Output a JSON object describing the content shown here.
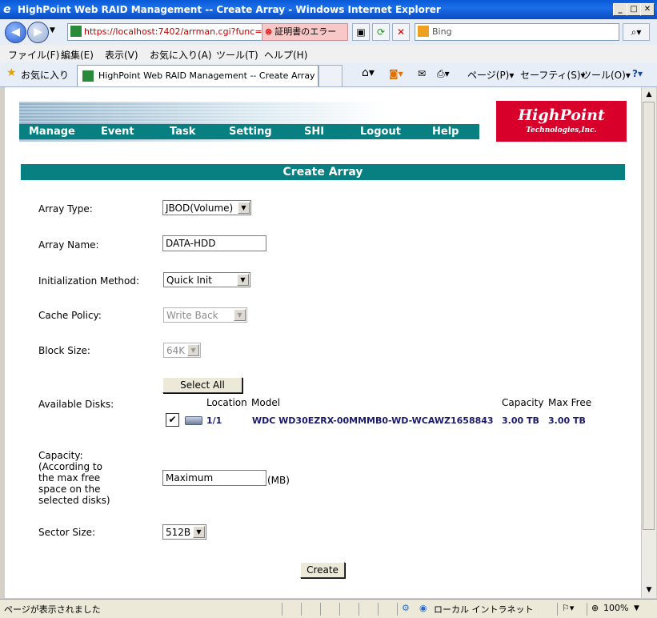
{
  "window": {
    "title": "HighPoint Web RAID Management -- Create Array - Windows Internet Explorer",
    "minimize": "_",
    "maximize": "□",
    "close": "✕"
  },
  "browser": {
    "url": "https://localhost:7402/arrman.cgi?func=",
    "cert_error": "証明書のエラー",
    "search_placeholder": "Bing",
    "menu": [
      "ファイル(F)",
      "編集(E)",
      "表示(V)",
      "お気に入り(A)",
      "ツール(T)",
      "ヘルプ(H)"
    ],
    "favorites": "お気に入り",
    "tab_title": "HighPoint Web RAID Management -- Create Array",
    "cmd_page": "ページ(P)",
    "cmd_safety": "セーフティ(S)",
    "cmd_tools": "ツール(O)",
    "status_text": "ページが表示されました",
    "zone": "ローカル イントラネット",
    "zoom": "100%"
  },
  "app": {
    "logo_line1": "HighPoint",
    "logo_line2": "Technologies,Inc.",
    "nav": [
      "Manage",
      "Event",
      "Task",
      "Setting",
      "SHI",
      "Logout",
      "Help"
    ],
    "page_title": "Create Array"
  },
  "form": {
    "array_type_label": "Array Type:",
    "array_type_value": "JBOD(Volume)",
    "array_name_label": "Array Name:",
    "array_name_value": "DATA-HDD",
    "init_method_label": "Initialization Method:",
    "init_method_value": "Quick Init",
    "cache_policy_label": "Cache Policy:",
    "cache_policy_value": "Write Back",
    "block_size_label": "Block Size:",
    "block_size_value": "64K",
    "select_all": "Select All",
    "available_disks_label": "Available Disks:",
    "disk_headers": {
      "location": "Location",
      "model": "Model",
      "capacity": "Capacity",
      "max_free": "Max Free"
    },
    "disks": [
      {
        "checked": "✔",
        "location": "1/1",
        "model": "WDC WD30EZRX-00MMMB0-WD-WCAWZ1658843",
        "capacity": "3.00 TB",
        "max_free": "3.00 TB"
      }
    ],
    "capacity_label_lines": [
      "Capacity:",
      "(According to",
      "the max free",
      "space on the",
      "selected disks)"
    ],
    "capacity_value": "Maximum",
    "capacity_unit": "(MB)",
    "sector_size_label": "Sector Size:",
    "sector_size_value": "512B",
    "create_button": "Create"
  }
}
